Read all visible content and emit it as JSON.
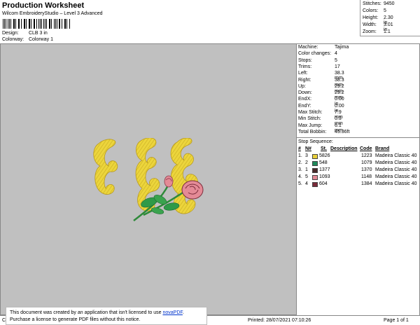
{
  "header": {
    "title": "Production Worksheet",
    "subtitle": "Wilcom EmbroideryStudio – Level 3 Advanced",
    "design_label": "Design:",
    "design_value": "CLB 3 in",
    "colorway_label": "Colorway:",
    "colorway_value": "Colorway 1"
  },
  "summary": {
    "stitches_label": "Stitches:",
    "stitches_value": "9450",
    "colors_label": "Colors:",
    "colors_value": "5",
    "height_label": "Height:",
    "height_value": "2.30 in",
    "width_label": "Width:",
    "width_value": "3.01 in",
    "zoom_label": "Zoom:",
    "zoom_value": "1:1"
  },
  "info": [
    {
      "label": "Machine:",
      "value": "Tajima"
    },
    {
      "label": "Color changes:",
      "value": "4"
    },
    {
      "label": "Stops:",
      "value": "5"
    },
    {
      "label": "Trims:",
      "value": "17"
    },
    {
      "label": "Left:",
      "value": "38.3 mm"
    },
    {
      "label": "Right:",
      "value": "38.3 mm"
    },
    {
      "label": "Up:",
      "value": "29.2 mm"
    },
    {
      "label": "Down:",
      "value": "29.2 mm"
    },
    {
      "label": "EndX:",
      "value": "0.00 in"
    },
    {
      "label": "EndY:",
      "value": "0.00 in"
    },
    {
      "label": "Max Stitch:",
      "value": "7.9 mm"
    },
    {
      "label": "Min Stitch:",
      "value": "0.3 mm"
    },
    {
      "label": "Max Jump:",
      "value": "6.1 mm"
    },
    {
      "label": "Total Bobbin:",
      "value": "45.36ft"
    }
  ],
  "stops": {
    "title": "Stop Sequence:",
    "headers": {
      "num": "#",
      "n": "N#",
      "st": "St.",
      "desc": "Description",
      "code": "Code",
      "brand": "Brand"
    },
    "rows": [
      {
        "num": "1.",
        "n": "3",
        "color": "#e8cf3a",
        "code_id": "5826",
        "stitches": "1223",
        "brand": "Madeira Classic 40"
      },
      {
        "num": "2.",
        "n": "2",
        "color": "#1f8a5a",
        "code_id": "548",
        "stitches": "1079",
        "brand": "Madeira Classic 40"
      },
      {
        "num": "3.",
        "n": "1",
        "color": "#4a2a2a",
        "code_id": "1377",
        "stitches": "1370",
        "brand": "Madeira Classic 40"
      },
      {
        "num": "4.",
        "n": "5",
        "color": "#e48a96",
        "code_id": "1093",
        "stitches": "1148",
        "brand": "Madeira Classic 40"
      },
      {
        "num": "5.",
        "n": "4",
        "color": "#7a2b3a",
        "code_id": "604",
        "stitches": "1384",
        "brand": "Madeira Classic 40"
      }
    ]
  },
  "footer": {
    "cr": "Cr",
    "printed": "Printed: 28/07/2021 07:10:26",
    "page": "Page 1 of 1"
  },
  "notice": {
    "line1": "This document was created by an application that isn't licensed to use",
    "link": "novaPDF",
    "line2": "Purchase a license to generate PDF files without this notice."
  }
}
